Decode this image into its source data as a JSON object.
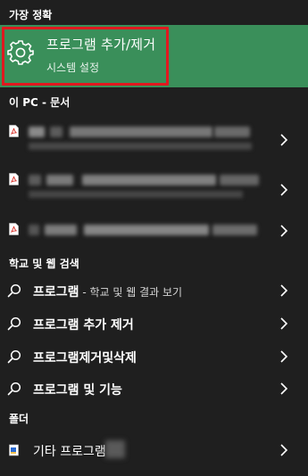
{
  "sections": {
    "best_match": "가장 정확",
    "this_pc_documents": "이 PC - 문서",
    "web_search": "학교 및 웹 검색",
    "folders": "폴더"
  },
  "best_match": {
    "icon": "gear-icon",
    "title": "프로그램 추가/제거",
    "subtitle": "시스템 설정"
  },
  "search_suggestions": [
    {
      "bold": "프로그램",
      "suffix": " - 학교 및 웹 결과 보기"
    },
    {
      "bold": "프로그램 추가 제거",
      "suffix": ""
    },
    {
      "bold": "프로그램제거및삭제",
      "suffix": ""
    },
    {
      "bold": "프로그램 및 기능",
      "suffix": ""
    }
  ],
  "folders": [
    {
      "label": "기타 프로그램"
    }
  ],
  "colors": {
    "background": "#1f1f1f",
    "best_match_bg": "#3a8f5a",
    "highlight_border": "#e0191f",
    "pdf_red": "#d9332b"
  }
}
